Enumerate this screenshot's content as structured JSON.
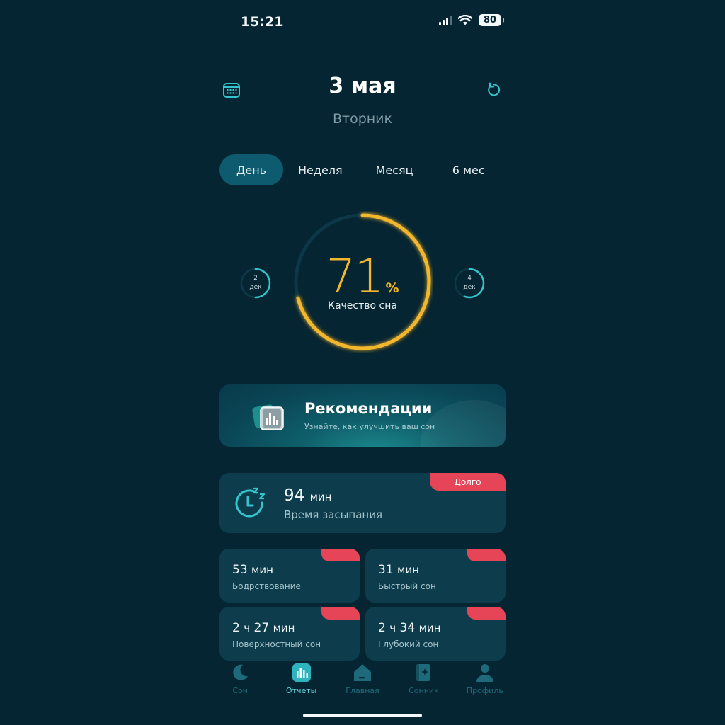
{
  "status_bar": {
    "time": "15:21",
    "battery": "80"
  },
  "header": {
    "title": "3 мая",
    "subtitle": "Вторник"
  },
  "tabs": [
    {
      "label": "День",
      "active": true
    },
    {
      "label": "Неделя",
      "active": false
    },
    {
      "label": "Месяц",
      "active": false
    },
    {
      "label": "6 мес",
      "active": false
    }
  ],
  "quality": {
    "value": "71",
    "unit": "%",
    "label": "Качество сна",
    "fraction": 0.71
  },
  "prev_day": {
    "day": "2",
    "month": "дек"
  },
  "next_day": {
    "day": "4",
    "month": "дек"
  },
  "recommendations": {
    "title": "Рекомендации",
    "subtitle": "Узнайте, как улучшить ваш сон"
  },
  "fall_asleep": {
    "value": "94",
    "unit": "мин",
    "label": "Время засыпания",
    "badge": "Долго"
  },
  "stats": [
    {
      "value": "53",
      "unit": "мин",
      "label": "Бодрствование"
    },
    {
      "value": "31",
      "unit": "мин",
      "label": "Быстрый сон"
    },
    {
      "value_h": "2",
      "unit_h": "ч",
      "value": "27",
      "unit": "мин",
      "label": "Поверхностный сон"
    },
    {
      "value_h": "2",
      "unit_h": "ч",
      "value": "34",
      "unit": "мин",
      "label": "Глубокий сон"
    }
  ],
  "nav": [
    {
      "label": "Сон",
      "icon": "moon-icon"
    },
    {
      "label": "Отчеты",
      "icon": "report-icon",
      "active": true
    },
    {
      "label": "Главная",
      "icon": "home-icon"
    },
    {
      "label": "Сонник",
      "icon": "book-icon"
    },
    {
      "label": "Профиль",
      "icon": "profile-icon"
    }
  ],
  "colors": {
    "background": "#062532",
    "accent": "#f3b72e",
    "teal": "#35c4cc",
    "badge": "#e64558",
    "card": "#0d3c4c"
  }
}
